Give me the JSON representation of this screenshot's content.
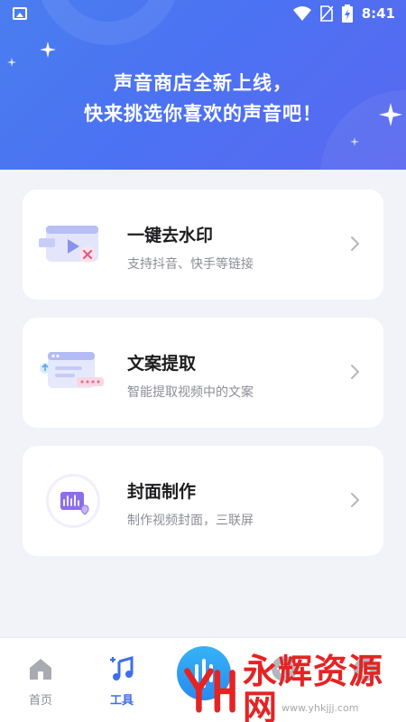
{
  "status_bar": {
    "time": "8:41",
    "icons": [
      "image-icon",
      "wifi-icon",
      "no-sim-icon",
      "battery-charging-icon"
    ]
  },
  "banner": {
    "line1": "声音商店全新上线，",
    "line2": "快来挑选你喜欢的声音吧！"
  },
  "tools": [
    {
      "title": "一键去水印",
      "subtitle": "支持抖音、快手等链接",
      "icon": "remove-watermark-icon"
    },
    {
      "title": "文案提取",
      "subtitle": "智能提取视频中的文案",
      "icon": "extract-text-icon"
    },
    {
      "title": "封面制作",
      "subtitle": "制作视频封面，三联屏",
      "icon": "cover-maker-icon"
    }
  ],
  "bottom_nav": {
    "items": [
      {
        "label": "首页",
        "icon": "home-icon",
        "active": false
      },
      {
        "label": "工具",
        "icon": "music-tools-icon",
        "active": true
      },
      {
        "label": "",
        "icon": "center-action-icon",
        "active": false
      },
      {
        "label": "",
        "icon": "voice-icon",
        "active": false
      },
      {
        "label": "",
        "icon": "profile-icon",
        "active": false
      }
    ]
  },
  "watermark": {
    "brand": "永辉资源网",
    "url": "www.yhkjjj.com"
  },
  "colors": {
    "accent": "#3c6df0",
    "banner_gradient_start": "#4a7ef0",
    "banner_gradient_end": "#5a68f0",
    "watermark_red": "#e52323"
  }
}
